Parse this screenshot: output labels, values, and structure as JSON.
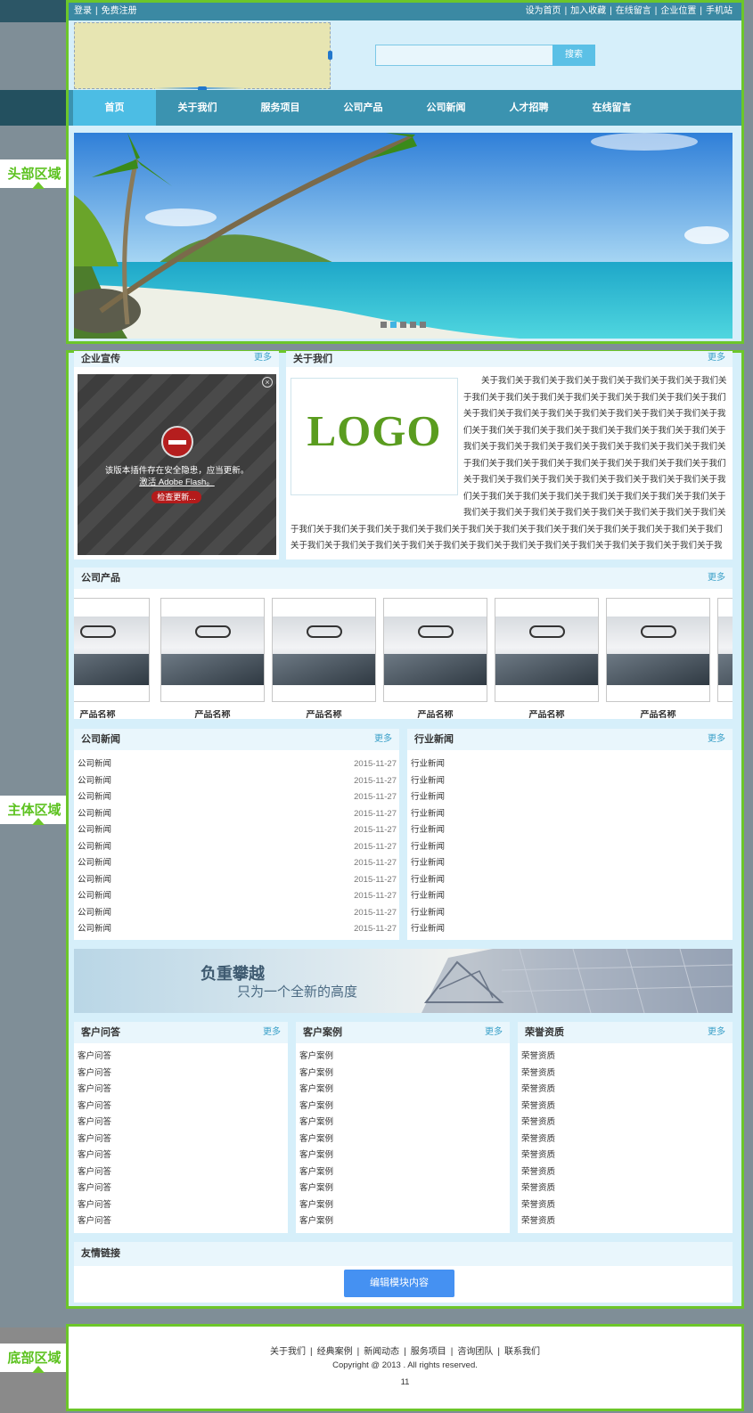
{
  "topbar": {
    "login": "登录",
    "register": "免费注册",
    "links": [
      "设为首页",
      "加入收藏",
      "在线留言",
      "企业位置",
      "手机站"
    ]
  },
  "search": {
    "placeholder": "",
    "button": "搜索"
  },
  "nav": [
    "首页",
    "关于我们",
    "服务项目",
    "公司产品",
    "公司新闻",
    "人才招聘",
    "在线留言"
  ],
  "nav_active": 0,
  "banner": {
    "slides": 5,
    "active": 1
  },
  "region_labels": {
    "header": "头部区域",
    "main": "主体区域",
    "footer": "底部区域"
  },
  "promo": {
    "title": "企业宣传",
    "more": "更多",
    "flash_msg": "该版本插件存在安全隐患，应当更新。",
    "flash_link": "激活 Adobe Flash。",
    "flash_btn": "检查更新..."
  },
  "about": {
    "title": "关于我们",
    "more": "更多",
    "logo_text": "LOGO",
    "body": "关于我们关于我们关于我们关于我们关于我们关于我们关于我们关于我们关于我们关于我们关于我们关于我们关于我们关于我们关于我们关于我们关于我们关于我们关于我们关于我们关于我们关于我们关于我们关于我们关于我们关于我们关于我们关于我们关于我们关于我们关于我们关于我们关于我们关于我们关于我们关于我们关于我们关于我们关于我们关于我们关于我们关于我们关于我们关于我们关于我们关于我们关于我们关于我们关于我们关于我们关于我们关于我们关于我们关于我们关于我们关于我们关于我们关于我们关于我们关于我们关于我们关于我们关于我们关于我们关于我们关于我们关于我们关于我们关于我们关于我们关于我们关于我们关于我们关于我们关于我们关于我们关于我们关于我们关于我们关于我们关于我们关于我们关于我们关于我们关于我们关于我们关于我们关于我们关于我们关于我们关于我们关于我们关于我们关于我们关于我们关于我们关于我们关于我们关于我们关于我们"
  },
  "products": {
    "title": "公司产品",
    "more": "更多",
    "items": [
      "产品名称",
      "产品名称",
      "产品名称",
      "产品名称",
      "产品名称",
      "产品名称"
    ]
  },
  "company_news": {
    "title": "公司新闻",
    "more": "更多",
    "items": [
      {
        "title": "公司新闻",
        "date": "2015-11-27"
      },
      {
        "title": "公司新闻",
        "date": "2015-11-27"
      },
      {
        "title": "公司新闻",
        "date": "2015-11-27"
      },
      {
        "title": "公司新闻",
        "date": "2015-11-27"
      },
      {
        "title": "公司新闻",
        "date": "2015-11-27"
      },
      {
        "title": "公司新闻",
        "date": "2015-11-27"
      },
      {
        "title": "公司新闻",
        "date": "2015-11-27"
      },
      {
        "title": "公司新闻",
        "date": "2015-11-27"
      },
      {
        "title": "公司新闻",
        "date": "2015-11-27"
      },
      {
        "title": "公司新闻",
        "date": "2015-11-27"
      },
      {
        "title": "公司新闻",
        "date": "2015-11-27"
      }
    ]
  },
  "industry_news": {
    "title": "行业新闻",
    "more": "更多",
    "items": [
      "行业新闻",
      "行业新闻",
      "行业新闻",
      "行业新闻",
      "行业新闻",
      "行业新闻",
      "行业新闻",
      "行业新闻",
      "行业新闻",
      "行业新闻",
      "行业新闻"
    ]
  },
  "ad_banner": {
    "line1": "负重攀越",
    "line2": "只为一个全新的高度"
  },
  "faq": {
    "title": "客户问答",
    "more": "更多",
    "items": [
      "客户问答",
      "客户问答",
      "客户问答",
      "客户问答",
      "客户问答",
      "客户问答",
      "客户问答",
      "客户问答",
      "客户问答",
      "客户问答",
      "客户问答"
    ]
  },
  "cases": {
    "title": "客户案例",
    "more": "更多",
    "items": [
      "客户案例",
      "客户案例",
      "客户案例",
      "客户案例",
      "客户案例",
      "客户案例",
      "客户案例",
      "客户案例",
      "客户案例",
      "客户案例",
      "客户案例"
    ]
  },
  "honors": {
    "title": "荣誉资质",
    "more": "更多",
    "items": [
      "荣誉资质",
      "荣誉资质",
      "荣誉资质",
      "荣誉资质",
      "荣誉资质",
      "荣誉资质",
      "荣誉资质",
      "荣誉资质",
      "荣誉资质",
      "荣誉资质",
      "荣誉资质"
    ]
  },
  "links": {
    "title": "友情链接",
    "edit_button": "编辑模块内容"
  },
  "footer": {
    "links": [
      "关于我们",
      "经典案例",
      "新闻动态",
      "服务项目",
      "咨询团队",
      "联系我们"
    ],
    "copyright": "Copyright @ 2013 . All rights reserved.",
    "counter": "11"
  },
  "colors": {
    "accent": "#3b93b0",
    "frame": "#6cc62a",
    "nav_active": "#4cbde4",
    "button": "#4591f2"
  }
}
